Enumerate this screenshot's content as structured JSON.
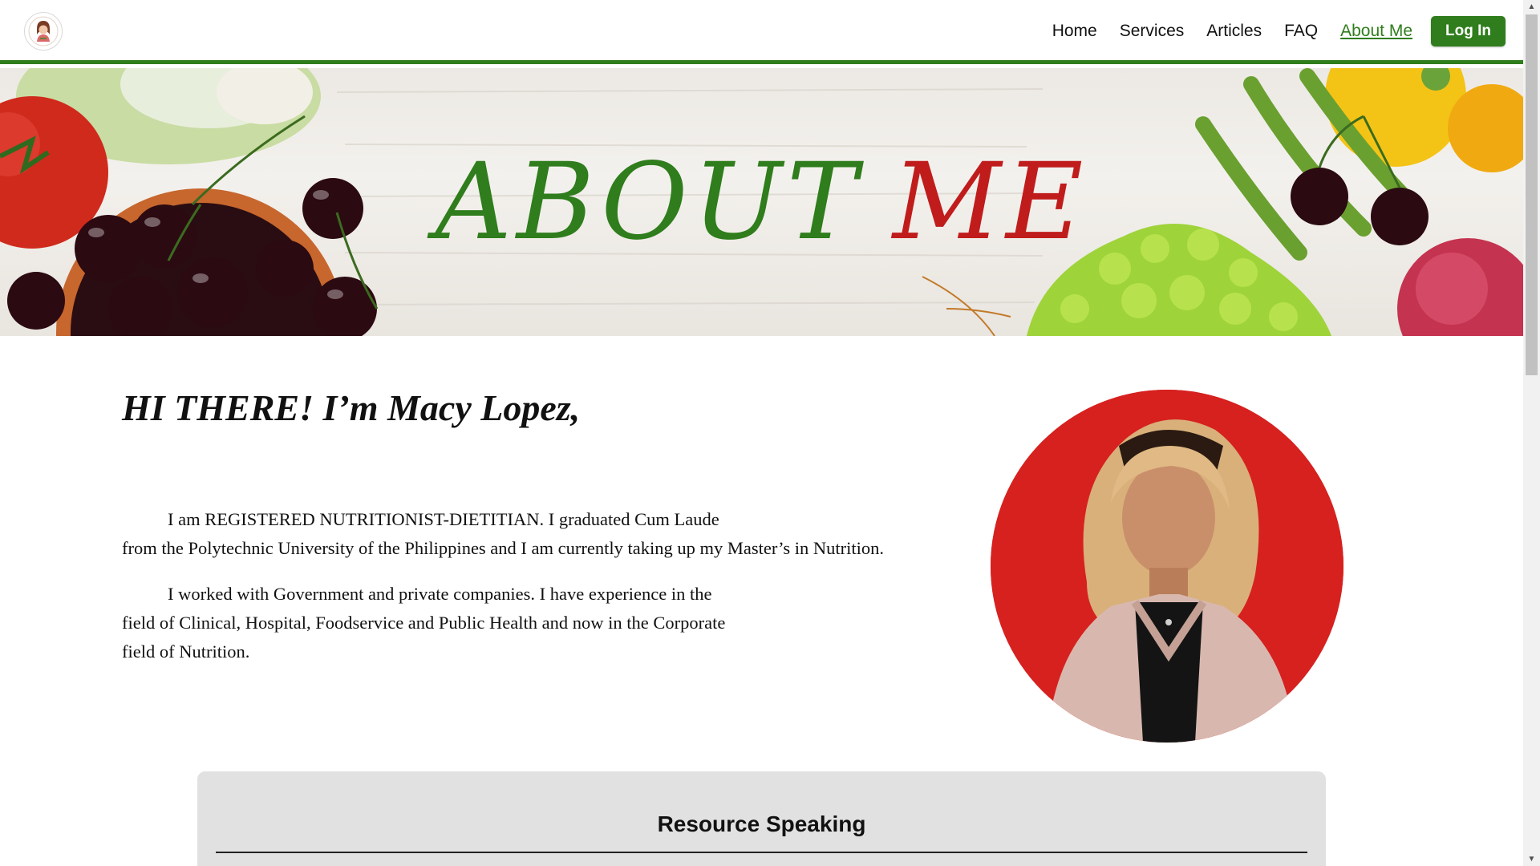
{
  "nav": {
    "links": [
      "Home",
      "Services",
      "Articles",
      "FAQ",
      "About Me"
    ],
    "active": "About Me",
    "login_label": "Log In"
  },
  "hero": {
    "title_word1": "ABOUT",
    "title_word2": "ME"
  },
  "about": {
    "greeting": "HI THERE! I’m Macy Lopez,",
    "para1_line1": "I am REGISTERED NUTRITIONIST-DIETITIAN. I graduated Cum Laude",
    "para1_line2": "from the Polytechnic University of the Philippines and I am currently taking up my Master’s in Nutrition.",
    "para2_line1": "I worked with Government and private companies. I have experience in the",
    "para2_line2": "field of Clinical, Hospital, Foodservice and Public Health and now in the Corporate",
    "para2_line3": "field of Nutrition."
  },
  "resource": {
    "title": "Resource Speaking"
  },
  "colors": {
    "brand_green": "#2f7d1c",
    "accent_red": "#c01c1c",
    "card_bg": "#e1e1e1"
  },
  "icons": {
    "logo": "woman-avatar-logo",
    "scroll_up": "chevron-up-icon",
    "scroll_down": "chevron-down-icon"
  }
}
